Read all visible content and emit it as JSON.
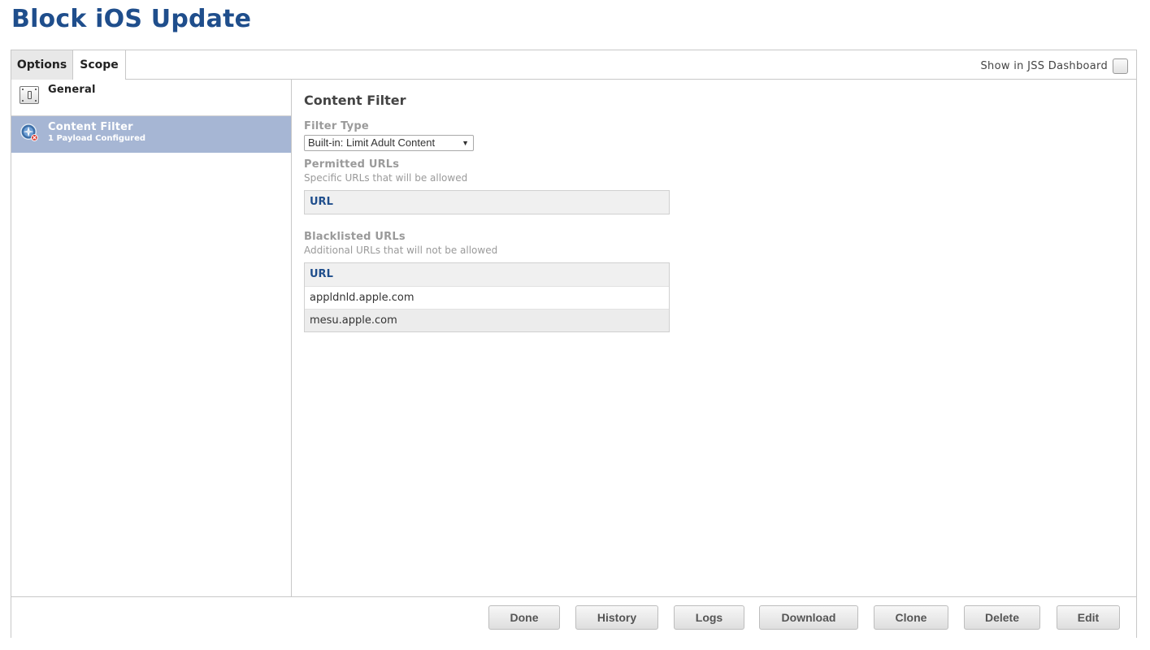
{
  "page": {
    "title": "Block iOS Update"
  },
  "tabs": [
    {
      "label": "Options",
      "active": true
    },
    {
      "label": "Scope",
      "active": false
    }
  ],
  "dashboard": {
    "label": "Show in JSS Dashboard",
    "checked": false
  },
  "sidebar": {
    "items": [
      {
        "label": "General",
        "icon": "switch-icon",
        "selected": false
      },
      {
        "label": "Content Filter",
        "sublabel": "1 Payload Configured",
        "icon": "compass-icon",
        "selected": true
      }
    ]
  },
  "content": {
    "section_title": "Content Filter",
    "filter_type": {
      "label": "Filter Type",
      "value": "Built-in: Limit Adult Content"
    },
    "permitted": {
      "label": "Permitted URLs",
      "description": "Specific URLs that will be allowed",
      "column": "URL",
      "rows": []
    },
    "blacklisted": {
      "label": "Blacklisted URLs",
      "description": "Additional URLs that will not be allowed",
      "column": "URL",
      "rows": [
        "appldnld.apple.com",
        "mesu.apple.com"
      ]
    }
  },
  "footer": {
    "buttons": [
      "Done",
      "History",
      "Logs",
      "Download",
      "Clone",
      "Delete",
      "Edit"
    ]
  },
  "colors": {
    "title_blue": "#1f4e8c",
    "selected_item": "#a6b6d4",
    "alert_red": "#d9342b"
  }
}
